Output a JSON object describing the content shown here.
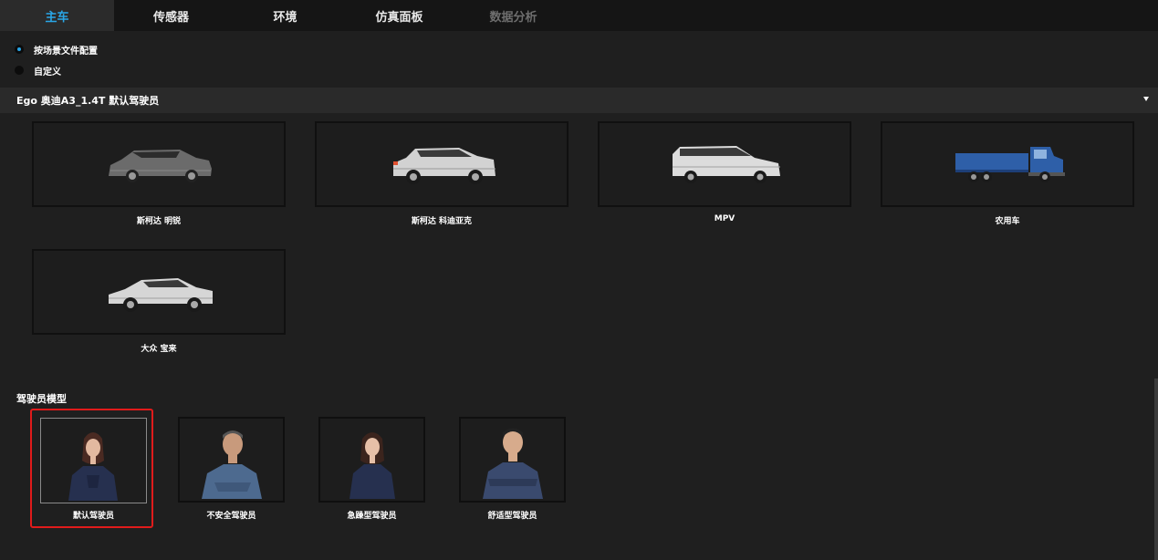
{
  "tabs": [
    {
      "label": "主车"
    },
    {
      "label": "传感器"
    },
    {
      "label": "环境"
    },
    {
      "label": "仿真面板"
    },
    {
      "label": "数据分析"
    }
  ],
  "config_options": [
    {
      "label": "按场景文件配置",
      "checked": true
    },
    {
      "label": "自定义",
      "checked": false
    }
  ],
  "vehicle_select": {
    "value": "Ego 奥迪A3_1.4T 默认驾驶员"
  },
  "vehicles": [
    {
      "label": "斯柯达 明锐",
      "icon": "station-wagon-icon",
      "color": "#6b6b6b"
    },
    {
      "label": "斯柯达 科迪亚克",
      "icon": "suv-icon",
      "color": "#cfcfcf"
    },
    {
      "label": "MPV",
      "icon": "mpv-icon",
      "color": "#d8d8d8"
    },
    {
      "label": "农用车",
      "icon": "truck-icon",
      "color": "#2e5fa8"
    },
    {
      "label": "大众 宝来",
      "icon": "sedan-icon",
      "color": "#d4d4d4"
    }
  ],
  "driver_section": {
    "title": "驾驶员模型"
  },
  "drivers": [
    {
      "label": "默认驾驶员",
      "icon": "female-driver-icon",
      "selected": true
    },
    {
      "label": "不安全驾驶员",
      "icon": "male-driver-icon",
      "selected": false
    },
    {
      "label": "急躁型驾驶员",
      "icon": "female-driver-icon",
      "selected": false
    },
    {
      "label": "舒适型驾驶员",
      "icon": "male-driver-icon",
      "selected": false
    }
  ],
  "colors": {
    "accent": "#2aa6e6",
    "highlight": "#e01b1b",
    "background": "#1f1f1f"
  }
}
